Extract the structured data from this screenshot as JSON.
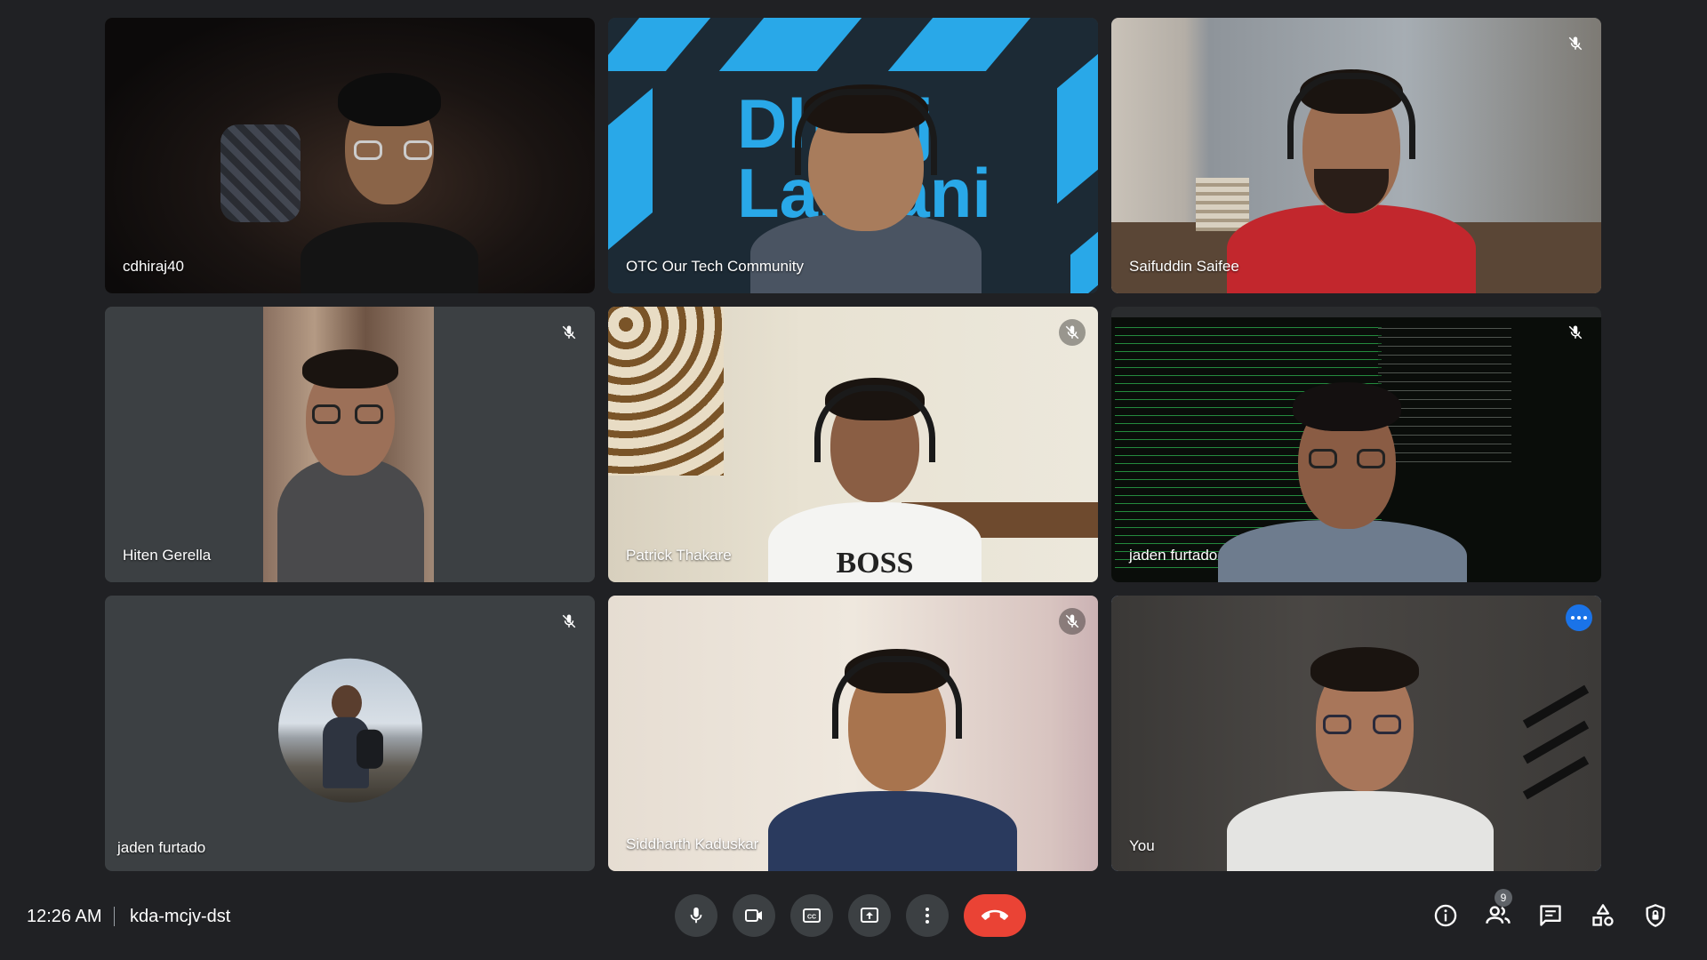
{
  "participants": [
    {
      "name": "cdhiraj40",
      "muted": false
    },
    {
      "name": "OTC Our Tech Community",
      "muted": false,
      "background_text": [
        "Dhiraj",
        "Lalwani"
      ]
    },
    {
      "name": "Saifuddin Saifee",
      "muted": true
    },
    {
      "name": "Hiten Gerella",
      "muted": true
    },
    {
      "name": "Patrick Thakare",
      "muted": true,
      "shirt_text": "BOSS"
    },
    {
      "name": "jaden furtado",
      "muted": true
    },
    {
      "name": "jaden furtado",
      "muted": true,
      "video_off": true
    },
    {
      "name": "Siddharth Kaduskar",
      "muted": true
    },
    {
      "name": "You",
      "muted": false,
      "selected": true
    }
  ],
  "bottom_bar": {
    "time": "12:26 AM",
    "meeting_code": "kda-mcjv-dst",
    "controls": [
      "mic-icon",
      "camera-icon",
      "captions-icon",
      "present-icon",
      "more-options-icon",
      "end-call-icon"
    ],
    "right_icons": [
      "info-icon",
      "people-icon",
      "chat-icon",
      "activities-icon",
      "host-controls-icon"
    ],
    "people_count": "9"
  },
  "colors": {
    "background": "#202124",
    "tile": "#3c4043",
    "accent": "#8ab4f8",
    "end_call": "#ea4335",
    "more_button": "#1a73e8"
  }
}
